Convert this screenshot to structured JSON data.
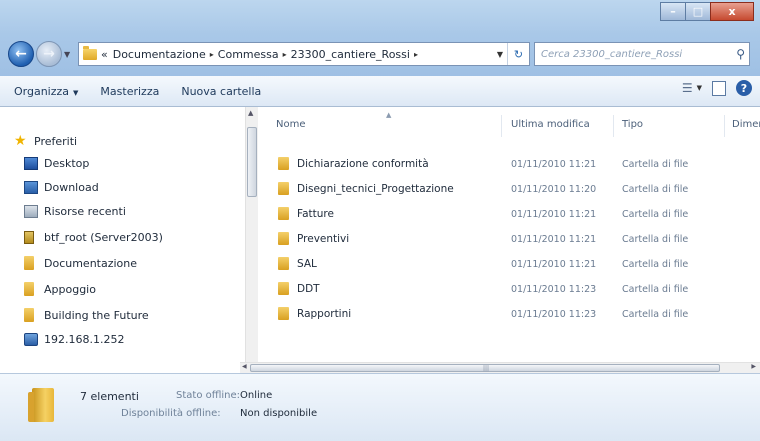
{
  "window": {
    "caption_buttons": {
      "minimize": "–",
      "maximize": "□",
      "close": "x"
    }
  },
  "address_bar": {
    "overflow": "«",
    "crumbs": [
      "Documentazione",
      "Commessa",
      "23300_cantiere_Rossi"
    ],
    "separator": "▸"
  },
  "search": {
    "placeholder": "Cerca 23300_cantiere_Rossi"
  },
  "command_bar": {
    "organize": "Organizza",
    "burn": "Masterizza",
    "new_folder": "Nuova cartella"
  },
  "nav_pane": {
    "favorites": "Preferiti",
    "items": [
      {
        "label": "Desktop",
        "icon": "desktop-icon"
      },
      {
        "label": "Download",
        "icon": "download-icon"
      },
      {
        "label": "Risorse recenti",
        "icon": "recent-places-icon"
      },
      {
        "label": "btf_root (Server2003)",
        "icon": "network-drive-icon"
      },
      {
        "label": "Documentazione",
        "icon": "folder-icon"
      },
      {
        "label": "Appoggio",
        "icon": "folder-icon"
      },
      {
        "label": "Building the Future",
        "icon": "folder-icon"
      },
      {
        "label": "192.168.1.252",
        "icon": "network-icon"
      }
    ]
  },
  "file_list": {
    "columns": {
      "name": "Nome",
      "modified": "Ultima modifica",
      "type": "Tipo",
      "size": "Dimer"
    },
    "rows": [
      {
        "name": "Dichiarazione conformità",
        "modified": "01/11/2010 11:21",
        "type": "Cartella di file"
      },
      {
        "name": "Disegni_tecnici_Progettazione",
        "modified": "01/11/2010 11:20",
        "type": "Cartella di file"
      },
      {
        "name": "Fatture",
        "modified": "01/11/2010 11:21",
        "type": "Cartella di file"
      },
      {
        "name": "Preventivi",
        "modified": "01/11/2010 11:21",
        "type": "Cartella di file"
      },
      {
        "name": "SAL",
        "modified": "01/11/2010 11:21",
        "type": "Cartella di file"
      },
      {
        "name": "DDT",
        "modified": "01/11/2010 11:23",
        "type": "Cartella di file"
      },
      {
        "name": "Rapportini",
        "modified": "01/11/2010 11:23",
        "type": "Cartella di file"
      }
    ]
  },
  "details": {
    "count": "7 elementi",
    "offline_status_label": "Stato offline:",
    "offline_status_value": "Online",
    "offline_availability_label": "Disponibilità offline:",
    "offline_availability_value": "Non disponibile"
  }
}
